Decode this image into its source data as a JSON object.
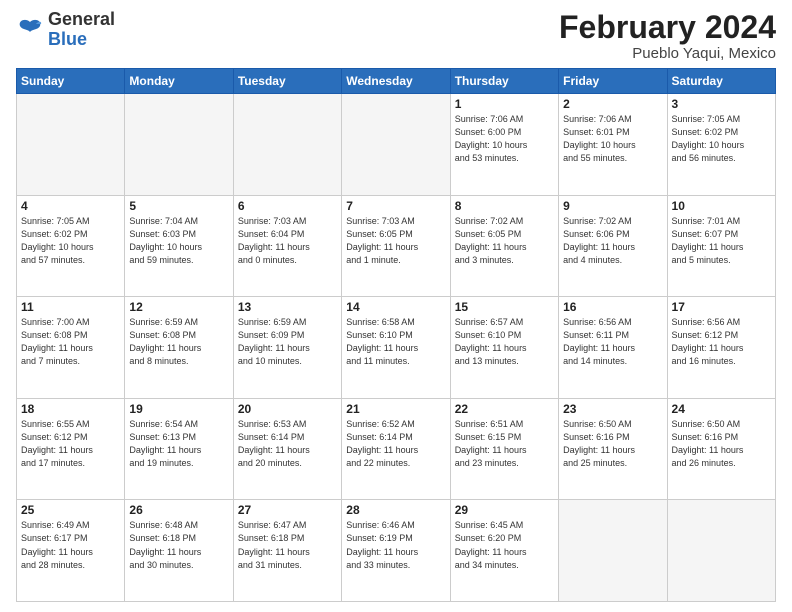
{
  "logo": {
    "general": "General",
    "blue": "Blue"
  },
  "header": {
    "title": "February 2024",
    "subtitle": "Pueblo Yaqui, Mexico"
  },
  "weekdays": [
    "Sunday",
    "Monday",
    "Tuesday",
    "Wednesday",
    "Thursday",
    "Friday",
    "Saturday"
  ],
  "weeks": [
    [
      {
        "day": "",
        "info": ""
      },
      {
        "day": "",
        "info": ""
      },
      {
        "day": "",
        "info": ""
      },
      {
        "day": "",
        "info": ""
      },
      {
        "day": "1",
        "info": "Sunrise: 7:06 AM\nSunset: 6:00 PM\nDaylight: 10 hours\nand 53 minutes."
      },
      {
        "day": "2",
        "info": "Sunrise: 7:06 AM\nSunset: 6:01 PM\nDaylight: 10 hours\nand 55 minutes."
      },
      {
        "day": "3",
        "info": "Sunrise: 7:05 AM\nSunset: 6:02 PM\nDaylight: 10 hours\nand 56 minutes."
      }
    ],
    [
      {
        "day": "4",
        "info": "Sunrise: 7:05 AM\nSunset: 6:02 PM\nDaylight: 10 hours\nand 57 minutes."
      },
      {
        "day": "5",
        "info": "Sunrise: 7:04 AM\nSunset: 6:03 PM\nDaylight: 10 hours\nand 59 minutes."
      },
      {
        "day": "6",
        "info": "Sunrise: 7:03 AM\nSunset: 6:04 PM\nDaylight: 11 hours\nand 0 minutes."
      },
      {
        "day": "7",
        "info": "Sunrise: 7:03 AM\nSunset: 6:05 PM\nDaylight: 11 hours\nand 1 minute."
      },
      {
        "day": "8",
        "info": "Sunrise: 7:02 AM\nSunset: 6:05 PM\nDaylight: 11 hours\nand 3 minutes."
      },
      {
        "day": "9",
        "info": "Sunrise: 7:02 AM\nSunset: 6:06 PM\nDaylight: 11 hours\nand 4 minutes."
      },
      {
        "day": "10",
        "info": "Sunrise: 7:01 AM\nSunset: 6:07 PM\nDaylight: 11 hours\nand 5 minutes."
      }
    ],
    [
      {
        "day": "11",
        "info": "Sunrise: 7:00 AM\nSunset: 6:08 PM\nDaylight: 11 hours\nand 7 minutes."
      },
      {
        "day": "12",
        "info": "Sunrise: 6:59 AM\nSunset: 6:08 PM\nDaylight: 11 hours\nand 8 minutes."
      },
      {
        "day": "13",
        "info": "Sunrise: 6:59 AM\nSunset: 6:09 PM\nDaylight: 11 hours\nand 10 minutes."
      },
      {
        "day": "14",
        "info": "Sunrise: 6:58 AM\nSunset: 6:10 PM\nDaylight: 11 hours\nand 11 minutes."
      },
      {
        "day": "15",
        "info": "Sunrise: 6:57 AM\nSunset: 6:10 PM\nDaylight: 11 hours\nand 13 minutes."
      },
      {
        "day": "16",
        "info": "Sunrise: 6:56 AM\nSunset: 6:11 PM\nDaylight: 11 hours\nand 14 minutes."
      },
      {
        "day": "17",
        "info": "Sunrise: 6:56 AM\nSunset: 6:12 PM\nDaylight: 11 hours\nand 16 minutes."
      }
    ],
    [
      {
        "day": "18",
        "info": "Sunrise: 6:55 AM\nSunset: 6:12 PM\nDaylight: 11 hours\nand 17 minutes."
      },
      {
        "day": "19",
        "info": "Sunrise: 6:54 AM\nSunset: 6:13 PM\nDaylight: 11 hours\nand 19 minutes."
      },
      {
        "day": "20",
        "info": "Sunrise: 6:53 AM\nSunset: 6:14 PM\nDaylight: 11 hours\nand 20 minutes."
      },
      {
        "day": "21",
        "info": "Sunrise: 6:52 AM\nSunset: 6:14 PM\nDaylight: 11 hours\nand 22 minutes."
      },
      {
        "day": "22",
        "info": "Sunrise: 6:51 AM\nSunset: 6:15 PM\nDaylight: 11 hours\nand 23 minutes."
      },
      {
        "day": "23",
        "info": "Sunrise: 6:50 AM\nSunset: 6:16 PM\nDaylight: 11 hours\nand 25 minutes."
      },
      {
        "day": "24",
        "info": "Sunrise: 6:50 AM\nSunset: 6:16 PM\nDaylight: 11 hours\nand 26 minutes."
      }
    ],
    [
      {
        "day": "25",
        "info": "Sunrise: 6:49 AM\nSunset: 6:17 PM\nDaylight: 11 hours\nand 28 minutes."
      },
      {
        "day": "26",
        "info": "Sunrise: 6:48 AM\nSunset: 6:18 PM\nDaylight: 11 hours\nand 30 minutes."
      },
      {
        "day": "27",
        "info": "Sunrise: 6:47 AM\nSunset: 6:18 PM\nDaylight: 11 hours\nand 31 minutes."
      },
      {
        "day": "28",
        "info": "Sunrise: 6:46 AM\nSunset: 6:19 PM\nDaylight: 11 hours\nand 33 minutes."
      },
      {
        "day": "29",
        "info": "Sunrise: 6:45 AM\nSunset: 6:20 PM\nDaylight: 11 hours\nand 34 minutes."
      },
      {
        "day": "",
        "info": ""
      },
      {
        "day": "",
        "info": ""
      }
    ]
  ]
}
